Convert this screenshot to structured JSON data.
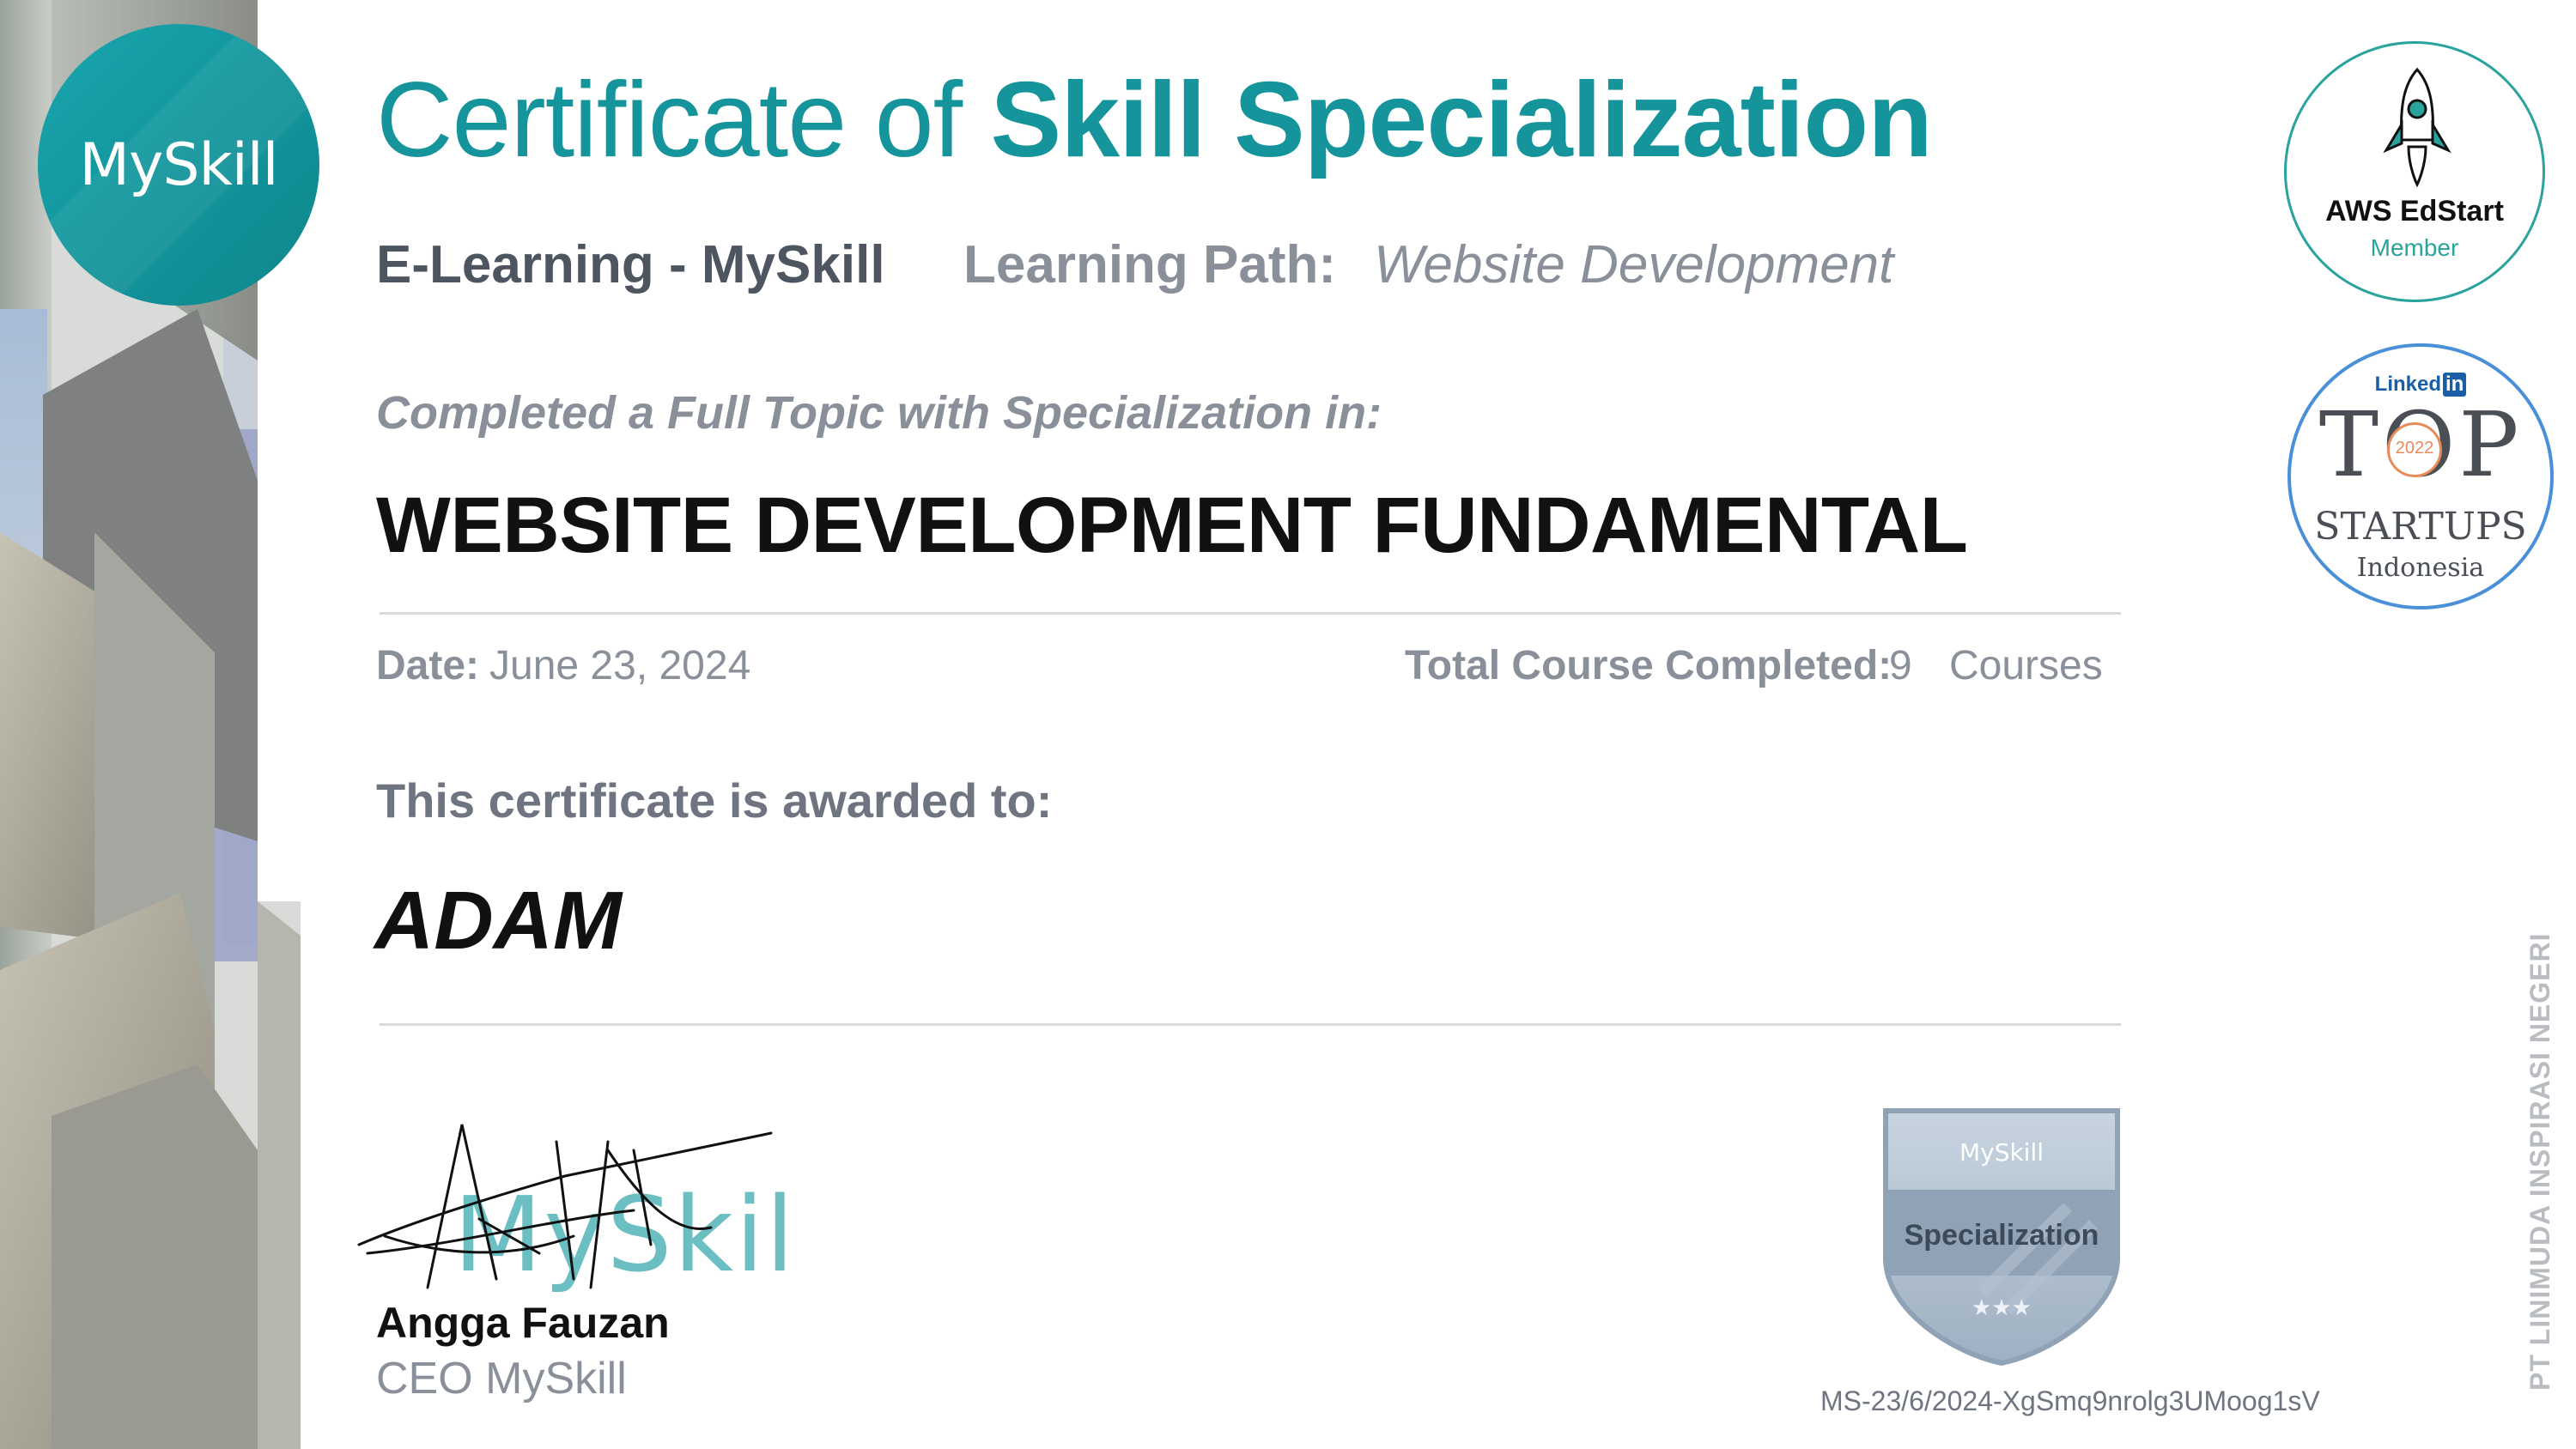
{
  "logo": {
    "wordmark": "MySkill"
  },
  "title": {
    "prefix": "Certificate of",
    "emphasis": "Skill Specialization"
  },
  "subheader": {
    "org": "E-Learning - MySkill",
    "learning_path_label": "Learning Path:",
    "learning_path_value": "Website Development"
  },
  "completed_label": "Completed a Full Topic with Specialization in:",
  "course_name": "WEBSITE DEVELOPMENT FUNDAMENTAL",
  "date": {
    "label": "Date:",
    "value": "June 23, 2024"
  },
  "total": {
    "label": "Total Course Completed:",
    "value": "9",
    "unit": "Courses"
  },
  "awarded_label": "This certificate is awarded to:",
  "recipient": "ADAM",
  "signer": {
    "name": "Angga Fauzan",
    "role": "CEO MySkill",
    "signature_overlay": "MySkill"
  },
  "badge": {
    "brand": "MySkill",
    "label": "Specialization",
    "stars": "★★★"
  },
  "certificate_id": "MS-23/6/2024-XgSmq9nrolg3UMoog1sV",
  "aws_badge": {
    "name": "AWS EdStart",
    "member": "Member"
  },
  "top_startups": {
    "linkedin": "Linked",
    "in": "in",
    "top": "TOP",
    "year": "2022",
    "startups": "STARTUPS",
    "country": "Indonesia"
  },
  "company": "PT LINIMUDA INSPIRASI NEGERI",
  "colors": {
    "brand_teal": "#16949b",
    "aws_teal": "#2aa39c",
    "linkedin_blue": "#1a5fa5"
  }
}
